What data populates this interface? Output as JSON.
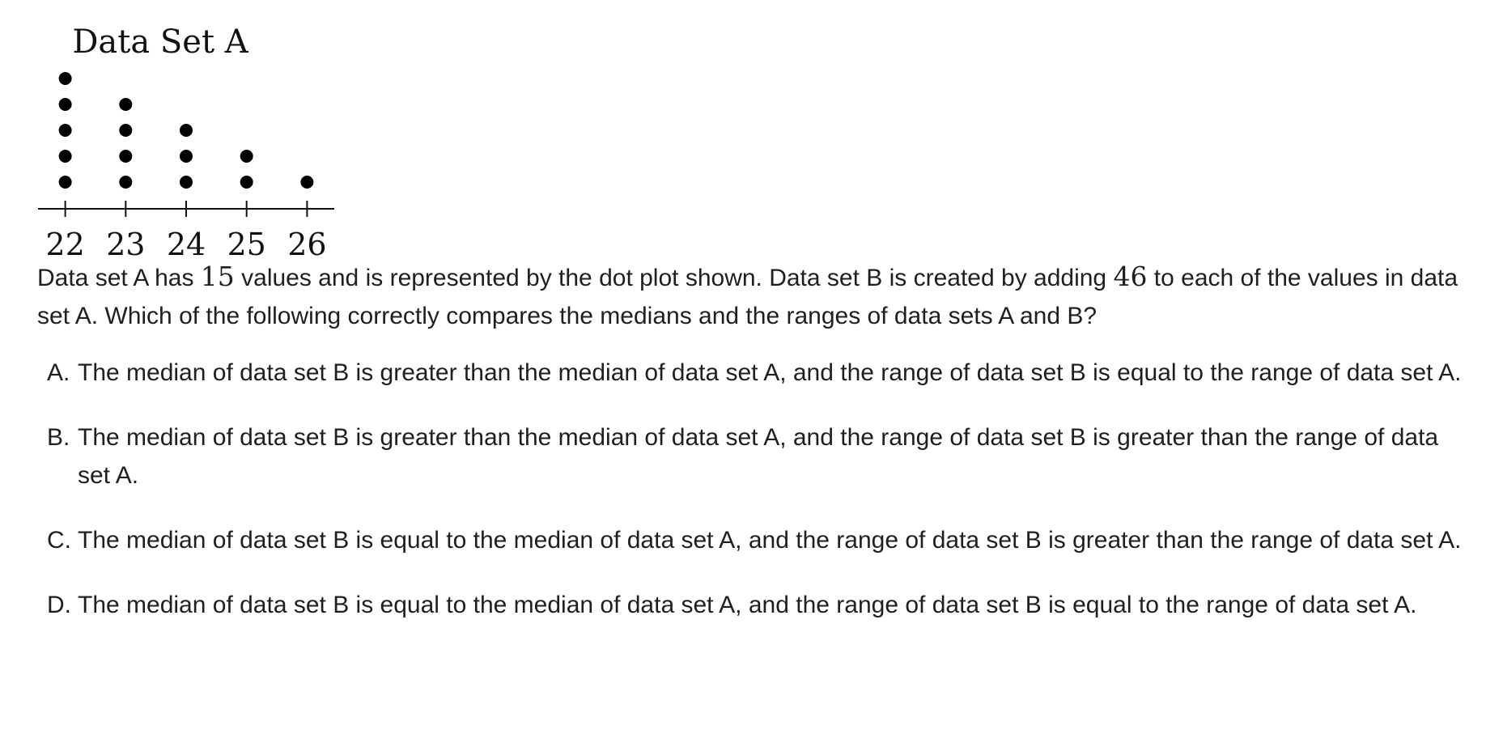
{
  "chart_data": {
    "type": "scatter",
    "subtype": "dot-plot",
    "title": "Data Set A",
    "x_ticks": [
      22,
      23,
      24,
      25,
      26
    ],
    "xlim": [
      21.55,
      26.45
    ],
    "counts": [
      {
        "x": 22,
        "count": 5
      },
      {
        "x": 23,
        "count": 4
      },
      {
        "x": 24,
        "count": 3
      },
      {
        "x": 25,
        "count": 2
      },
      {
        "x": 26,
        "count": 1
      }
    ],
    "xlabel": "",
    "ylabel": "",
    "grid": false
  },
  "question": {
    "part1": "Data set A has ",
    "n_values": "15",
    "part2": " values and is represented by the dot plot shown. Data set B is created by adding ",
    "added": "46",
    "part3": " to each of the values in data set A. Which of the following correctly compares the medians and the ranges of data sets A and B?"
  },
  "options": [
    {
      "letter": "A.",
      "text": "The median of data set B is greater than the median of data set A, and the range of data set B is equal to the range of data set A."
    },
    {
      "letter": "B.",
      "text": "The median of data set B is greater than the median of data set A, and the range of data set B is greater than the range of data set A."
    },
    {
      "letter": "C.",
      "text": "The median of data set B is equal to the median of data set A, and the range of data set B is greater than the range of data set A."
    },
    {
      "letter": "D.",
      "text": "The median of data set B is equal to the median of data set A, and the range of data set B is equal to the range of data set A."
    }
  ]
}
